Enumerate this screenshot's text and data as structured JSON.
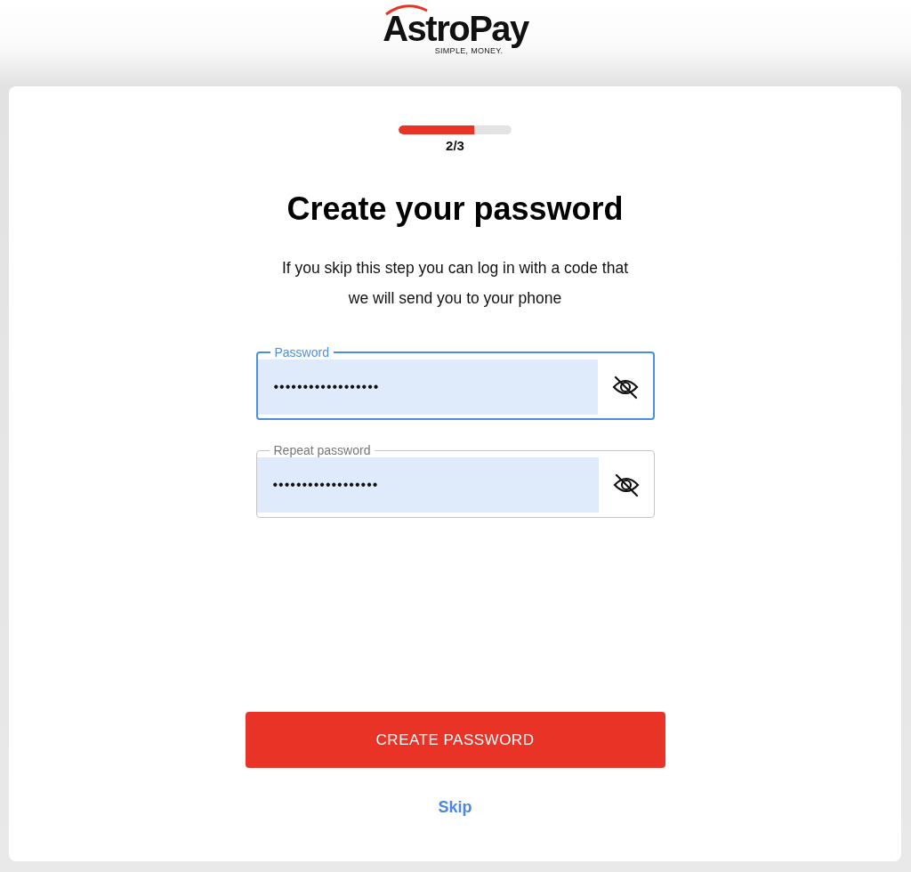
{
  "logo": {
    "name": "AstroPay",
    "tagline": "SIMPLE, MONEY."
  },
  "progress": {
    "level": 0.67,
    "label": "2/3"
  },
  "title": "Create your password",
  "subtitle": "If you skip this step you can log in with a code that we will send you to your phone",
  "fields": [
    {
      "label": "Password",
      "value": "••••••••••••••••••",
      "focused": true
    },
    {
      "label": "Repeat password",
      "value": "••••••••••••••••••",
      "focused": false
    }
  ],
  "primary_button": "CREATE PASSWORD",
  "skip_link": "Skip"
}
